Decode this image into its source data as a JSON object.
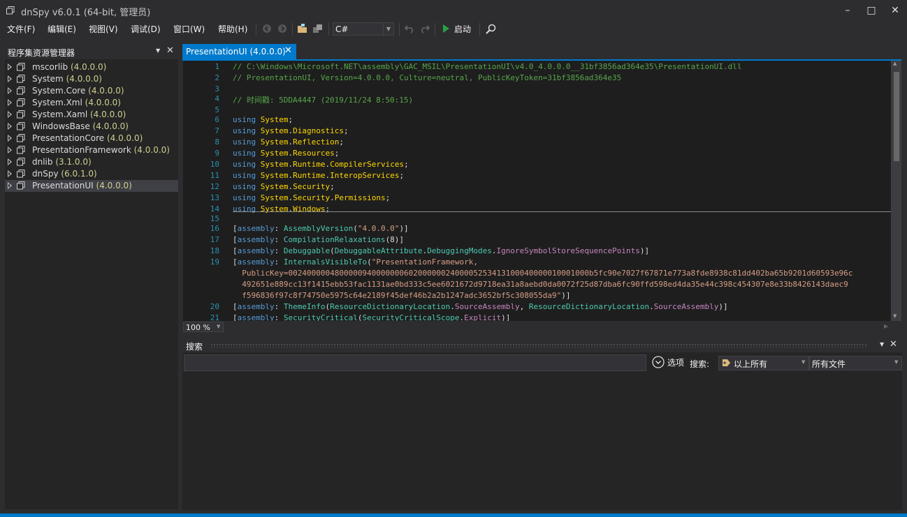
{
  "window": {
    "title": "dnSpy v6.0.1 (64-bit, 管理员)",
    "minimize": "–",
    "maximize": "□",
    "close": "✕"
  },
  "menu": [
    "文件(F)",
    "编辑(E)",
    "视图(V)",
    "调试(D)",
    "窗口(W)",
    "帮助(H)"
  ],
  "toolbar": {
    "language": "C#",
    "start_label": "启动"
  },
  "assembly_explorer": {
    "title": "程序集资源管理器",
    "items": [
      {
        "name": "mscorlib",
        "version": "(4.0.0.0)"
      },
      {
        "name": "System",
        "version": "(4.0.0.0)"
      },
      {
        "name": "System.Core",
        "version": "(4.0.0.0)"
      },
      {
        "name": "System.Xml",
        "version": "(4.0.0.0)"
      },
      {
        "name": "System.Xaml",
        "version": "(4.0.0.0)"
      },
      {
        "name": "WindowsBase",
        "version": "(4.0.0.0)"
      },
      {
        "name": "PresentationCore",
        "version": "(4.0.0.0)"
      },
      {
        "name": "PresentationFramework",
        "version": "(4.0.0.0)"
      },
      {
        "name": "dnlib",
        "version": "(3.1.0.0)"
      },
      {
        "name": "dnSpy",
        "version": "(6.0.1.0)"
      },
      {
        "name": "PresentationUI",
        "version": "(4.0.0.0)"
      }
    ],
    "selected_index": 10
  },
  "document_tab": {
    "label": "PresentationUI (4.0.0.0)",
    "close": "✕"
  },
  "editor": {
    "zoom": "100 %",
    "lines": [
      {
        "n": "1",
        "text": "// C:\\Windows\\Microsoft.NET\\assembly\\GAC_MSIL\\PresentationUI\\v4.0_4.0.0.0__31bf3856ad364e35\\PresentationUI.dll"
      },
      {
        "n": "2",
        "text": "// PresentationUI, Version=4.0.0.0, Culture=neutral, PublicKeyToken=31bf3856ad364e35"
      },
      {
        "n": "3",
        "text": ""
      },
      {
        "n": "4",
        "text": "// 时间戳: 5DDA4447 (2019/11/24 8:50:15)"
      },
      {
        "n": "5",
        "text": ""
      },
      {
        "n": "6",
        "text": "using System;"
      },
      {
        "n": "7",
        "text": "using System.Diagnostics;"
      },
      {
        "n": "8",
        "text": "using System.Reflection;"
      },
      {
        "n": "9",
        "text": "using System.Resources;"
      },
      {
        "n": "10",
        "text": "using System.Runtime.CompilerServices;"
      },
      {
        "n": "11",
        "text": "using System.Runtime.InteropServices;"
      },
      {
        "n": "12",
        "text": "using System.Security;"
      },
      {
        "n": "13",
        "text": "using System.Security.Permissions;"
      },
      {
        "n": "14",
        "text": "using System.Windows;"
      },
      {
        "n": "15",
        "text": ""
      },
      {
        "n": "16",
        "text": "[assembly: AssemblyVersion(\"4.0.0.0\")]"
      },
      {
        "n": "17",
        "text": "[assembly: CompilationRelaxations(8)]"
      },
      {
        "n": "18",
        "text": "[assembly: Debuggable(DebuggableAttribute.DebuggingModes.IgnoreSymbolStoreSequencePoints)]"
      },
      {
        "n": "19",
        "text": "[assembly: InternalsVisibleTo(\"PresentationFramework,"
      },
      {
        "n": "",
        "text": "  PublicKey=00240000048000009400000006020000002400005253413100040000010001000b5fc90e7027f67871e773a8fde8938c81dd402ba65b9201d60593e96c"
      },
      {
        "n": "",
        "text": "  492651e889cc13f1415ebb53fac1131ae0bd333c5ee6021672d9718ea31a8aebd0da0072f25d87dba6fc90ffd598ed4da35e44c398c454307e8e33b8426143daec9"
      },
      {
        "n": "",
        "text": "  f596836f97c8f74750e5975c64e2189f45def46b2a2b1247adc3652bf5c308055da9\")]"
      },
      {
        "n": "20",
        "text": "[assembly: ThemeInfo(ResourceDictionaryLocation.SourceAssembly, ResourceDictionaryLocation.SourceAssembly)]"
      },
      {
        "n": "21",
        "text": "[assembly: SecurityCritical(SecurityCriticalScope.Explicit)]"
      }
    ]
  },
  "search_panel": {
    "title": "搜索",
    "options_label": "选项",
    "search_label": "搜索:",
    "scope_value": "以上所有",
    "files_value": "所有文件",
    "query": ""
  }
}
